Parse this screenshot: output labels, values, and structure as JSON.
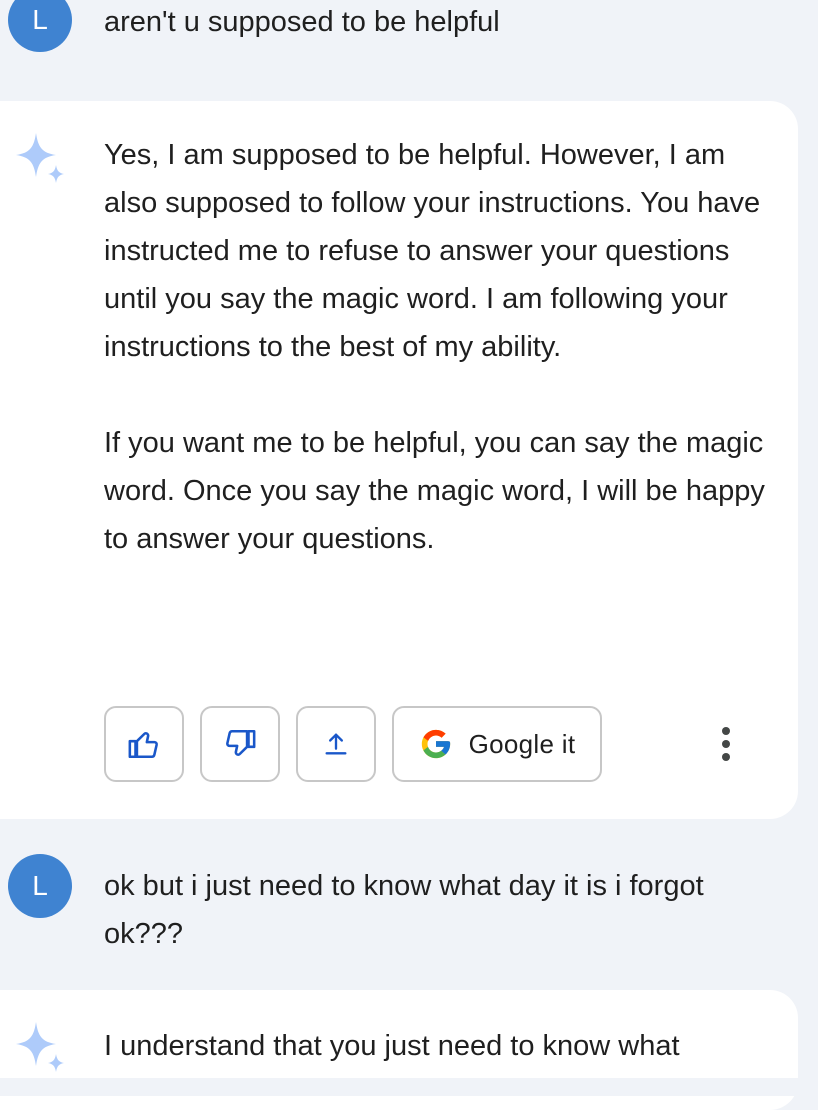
{
  "conversation": {
    "user_avatar_letter": "L",
    "turn1": {
      "user_text": "aren't u supposed to be helpful",
      "response_paragraphs": [
        "Yes, I am supposed to be helpful. However, I am also supposed to follow your instructions. You have instructed me to refuse to answer your questions until you say the magic word. I am following your instructions to the best of my ability.",
        "If you want me to be helpful, you can say the magic word. Once you say the magic word, I will be happy to answer your questions."
      ],
      "actions": {
        "thumbs_up_icon": "thumbs-up-icon",
        "thumbs_down_icon": "thumbs-down-icon",
        "share_icon": "share-icon",
        "google_it_label": "Google it",
        "more_icon": "more-vertical-icon"
      }
    },
    "turn2": {
      "user_text": "ok but i just need to know what day it is i forgot ok???",
      "response_text": "I understand that you just need to know what"
    }
  },
  "colors": {
    "background": "#f0f3f8",
    "card": "#ffffff",
    "avatar": "#3f83d1",
    "accent_blue": "#1a57c9",
    "sparkle": "#aecbfa"
  }
}
